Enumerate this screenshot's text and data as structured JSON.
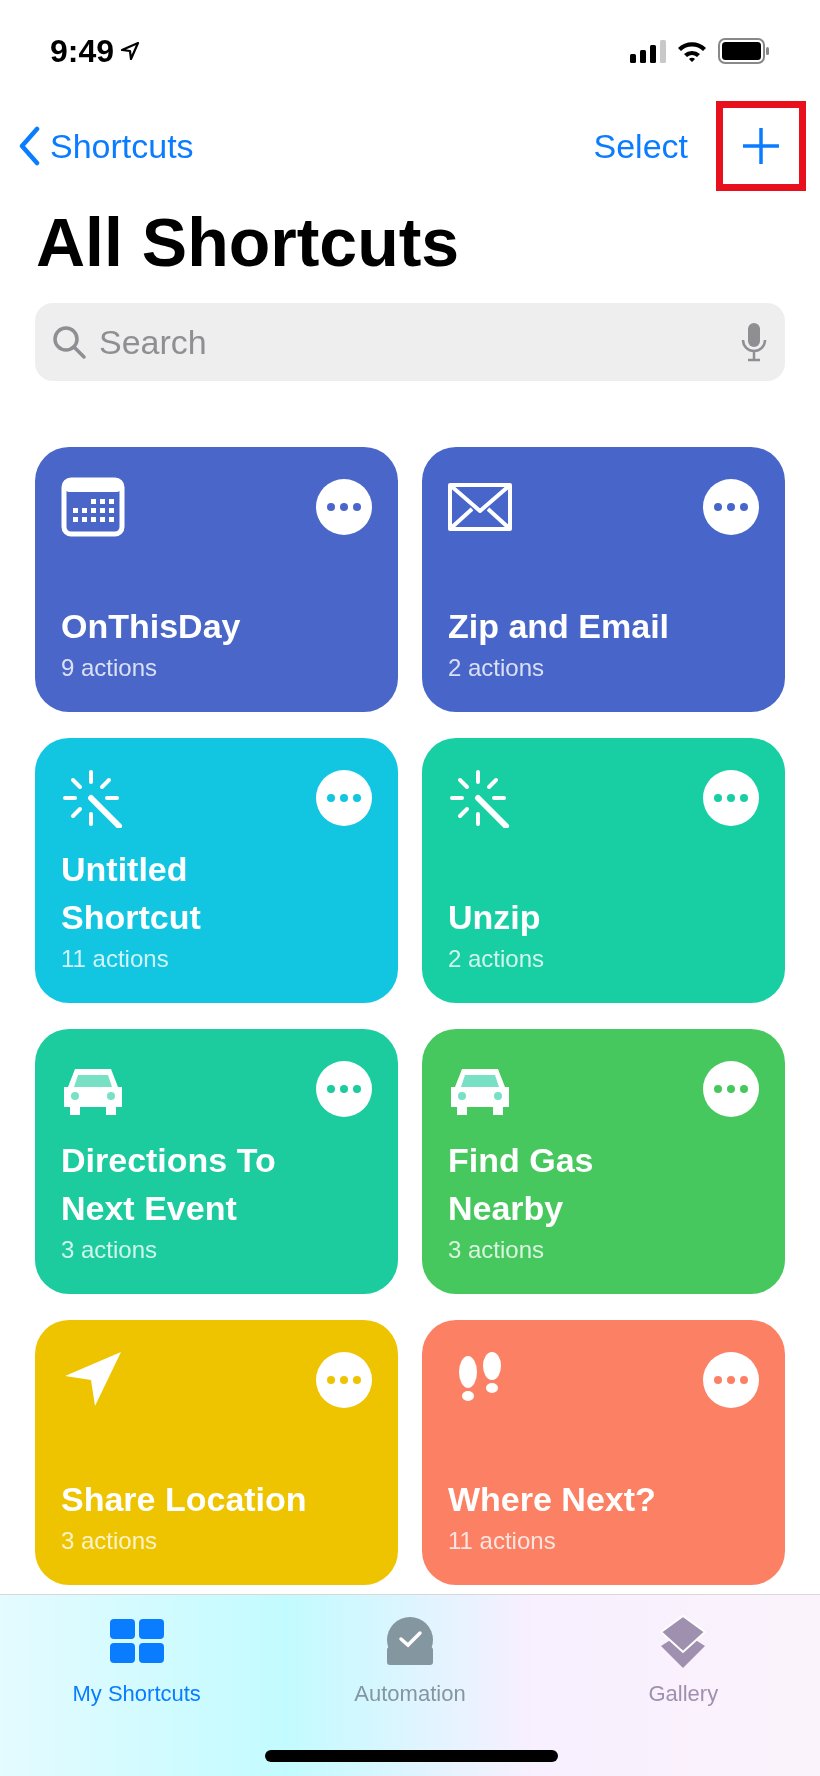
{
  "status_bar": {
    "time": "9:49"
  },
  "nav": {
    "back": "Shortcuts",
    "select": "Select",
    "add_highlighted": true
  },
  "title": "All Shortcuts",
  "search": {
    "placeholder": "Search"
  },
  "shortcuts": [
    {
      "title_lines": [
        "OnThisDay"
      ],
      "subtitle": "9 actions",
      "color": "#4a66c8"
    },
    {
      "title_lines": [
        "Zip and Email"
      ],
      "subtitle": "2 actions",
      "color": "#4866c9"
    },
    {
      "title_lines": [
        "Untitled",
        "Shortcut"
      ],
      "subtitle": "11 actions",
      "color": "#12c6e2"
    },
    {
      "title_lines": [
        "Unzip"
      ],
      "subtitle": "2 actions",
      "color": "#18cfa4"
    },
    {
      "title_lines": [
        "Directions To",
        "Next Event"
      ],
      "subtitle": "3 actions",
      "color": "#1ccc9e"
    },
    {
      "title_lines": [
        "Find Gas",
        "Nearby"
      ],
      "subtitle": "3 actions",
      "color": "#46c85e"
    },
    {
      "title_lines": [
        "Share Location"
      ],
      "subtitle": "3 actions",
      "color": "#eec400"
    },
    {
      "title_lines": [
        "Where Next?"
      ],
      "subtitle": "11 actions",
      "color": "#fc8064"
    }
  ],
  "tabs": [
    {
      "label": "My Shortcuts",
      "selected": true
    },
    {
      "label": "Automation",
      "selected": false
    },
    {
      "label": "Gallery",
      "selected": false
    }
  ]
}
